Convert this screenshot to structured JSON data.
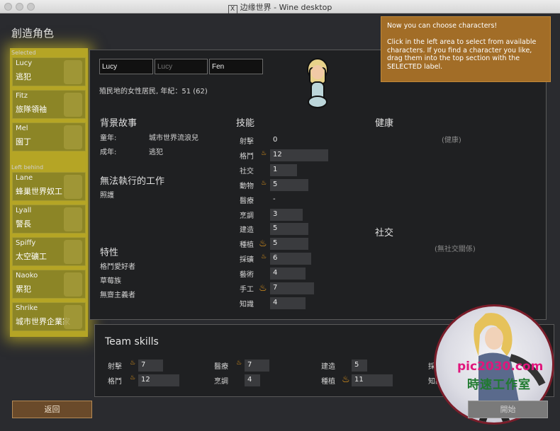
{
  "window": {
    "title": "边缘世界 - Wine desktop"
  },
  "screen_title": "創造角色",
  "left": {
    "selected_label": "Selected",
    "selected": [
      {
        "name": "Lucy",
        "role": "逃犯"
      },
      {
        "name": "Fitz",
        "role": "旅隊領袖"
      },
      {
        "name": "Mel",
        "role": "園丁"
      }
    ],
    "behind_label": "Left behind",
    "behind": [
      {
        "name": "Lane",
        "role": "蜂巢世界奴工"
      },
      {
        "name": "Lyall",
        "role": "警長"
      },
      {
        "name": "Spiffy",
        "role": "太空礦工"
      },
      {
        "name": "Naoko",
        "role": "累犯"
      },
      {
        "name": "Shrike",
        "role": "城市世界企業家"
      }
    ]
  },
  "tooltip": "Now you can choose characters!\n\nClick in the left area to select from available characters. If you find a character you like, drag them into the top section with the SELECTED label.",
  "character": {
    "first": "Lucy",
    "nick_placeholder": "Lucy",
    "last": "Fen",
    "desc": "殖民地的女性居民, 年紀：51 (62)"
  },
  "backstory": {
    "title": "背景故事",
    "childhood_label": "童年:",
    "childhood": "城市世界流浪兒",
    "adulthood_label": "成年:",
    "adulthood": "逃犯"
  },
  "incapable": {
    "title": "無法執行的工作",
    "items": [
      "照護"
    ]
  },
  "traits": {
    "title": "特性",
    "items": [
      "格鬥愛好者",
      "草莓族",
      "無齋主義者"
    ]
  },
  "skills": {
    "title": "技能",
    "list": [
      {
        "name": "射擊",
        "value": "0",
        "passion": 0,
        "bar": 0
      },
      {
        "name": "格鬥",
        "value": "12",
        "passion": 1,
        "bar": 0.6
      },
      {
        "name": "社交",
        "value": "1",
        "passion": 0,
        "bar": 0.05
      },
      {
        "name": "動物",
        "value": "5",
        "passion": 1,
        "bar": 0.25
      },
      {
        "name": "醫療",
        "value": "-",
        "passion": 0,
        "bar": 0
      },
      {
        "name": "烹調",
        "value": "3",
        "passion": 0,
        "bar": 0.15
      },
      {
        "name": "建造",
        "value": "5",
        "passion": 0,
        "bar": 0.25
      },
      {
        "name": "種植",
        "value": "5",
        "passion": 2,
        "bar": 0.25
      },
      {
        "name": "採礦",
        "value": "6",
        "passion": 1,
        "bar": 0.3
      },
      {
        "name": "藝術",
        "value": "4",
        "passion": 0,
        "bar": 0.2
      },
      {
        "name": "手工",
        "value": "7",
        "passion": 2,
        "bar": 0.35
      },
      {
        "name": "知識",
        "value": "4",
        "passion": 0,
        "bar": 0.2
      }
    ]
  },
  "health": {
    "title": "健康",
    "empty": "(健康)"
  },
  "social": {
    "title": "社交",
    "empty": "(無社交關係)"
  },
  "team": {
    "title": "Team skills",
    "items": [
      {
        "name": "射擊",
        "value": "7",
        "passion": 1
      },
      {
        "name": "格鬥",
        "value": "12",
        "passion": 1
      },
      {
        "name": "醫療",
        "value": "7",
        "passion": 1
      },
      {
        "name": "烹調",
        "value": "4",
        "passion": 0
      },
      {
        "name": "建造",
        "value": "5",
        "passion": 0
      },
      {
        "name": "種植",
        "value": "11",
        "passion": 2
      },
      {
        "name": "採礦",
        "value": "",
        "passion": 1
      },
      {
        "name": "知識",
        "value": "",
        "passion": 0
      }
    ]
  },
  "buttons": {
    "back": "返回",
    "next": "開始"
  },
  "watermark": {
    "line1": "pic2030.com",
    "line2": "時速工作室"
  }
}
